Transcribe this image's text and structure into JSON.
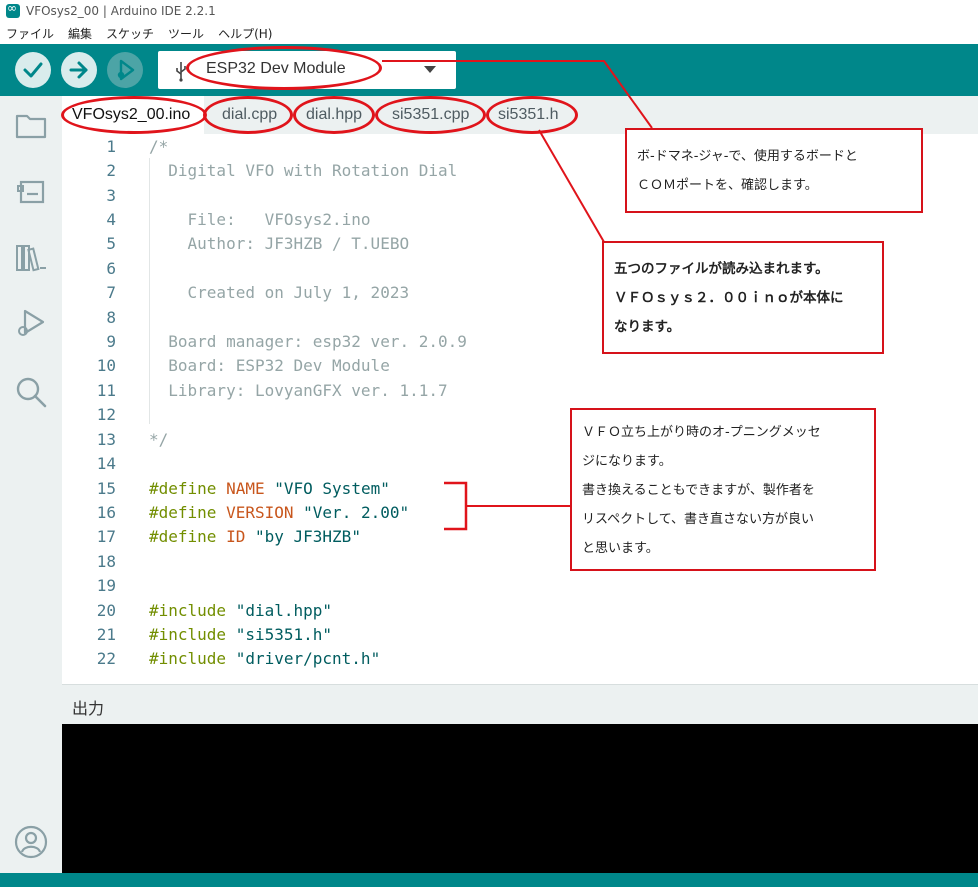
{
  "window": {
    "title": "VFOsys2_00 | Arduino IDE 2.2.1"
  },
  "menu": [
    "ファイル",
    "編集",
    "スケッチ",
    "ツール",
    "ヘルプ(H)"
  ],
  "toolbar": {
    "board": "ESP32 Dev Module"
  },
  "tabs": [
    "VFOsys2_00.ino",
    "dial.cpp",
    "dial.hpp",
    "si5351.cpp",
    "si5351.h"
  ],
  "code_lines": [
    "/*",
    "  Digital VFO with Rotation Dial",
    "",
    "    File:   VFOsys2.ino",
    "    Author: JF3HZB / T.UEBO",
    "",
    "    Created on July 1, 2023",
    "",
    "  Board manager: esp32 ver. 2.0.9",
    "  Board: ESP32 Dev Module",
    "  Library: LovyanGFX ver. 1.1.7",
    "",
    "*/",
    "",
    "#define NAME \"VFO System\"",
    "#define VERSION \"Ver. 2.00\"",
    "#define ID \"by JF3HZB\"",
    "",
    "",
    "#include \"dial.hpp\"",
    "#include \"si5351.h\"",
    "#include \"driver/pcnt.h\""
  ],
  "line_numbers": [
    "1",
    "2",
    "3",
    "4",
    "5",
    "6",
    "7",
    "8",
    "9",
    "10",
    "11",
    "12",
    "13",
    "14",
    "15",
    "16",
    "17",
    "18",
    "19",
    "20",
    "21",
    "22"
  ],
  "output": {
    "title": "出力"
  },
  "annotations": {
    "note1": [
      "ボ-ドマネ-ジャ-で、使用するボードと",
      "ＣＯＭポートを、確認します。"
    ],
    "note2": [
      "五つのファイルが読み込まれます。",
      "ＶＦＯｓｙｓ２．００ｉｎｏが本体に",
      "なります。"
    ],
    "note3": [
      "ＶＦＯ立ち上がり時のオ-プニングメッセ",
      "ジになります。",
      "書き換えることもできますが、製作者を",
      "リスペクトして、書き直さない方が良い",
      "と思います。"
    ]
  },
  "colors": {
    "teal": "#00878a",
    "annotation_red": "#e0141b",
    "sidebar": "#ecf1f1"
  }
}
